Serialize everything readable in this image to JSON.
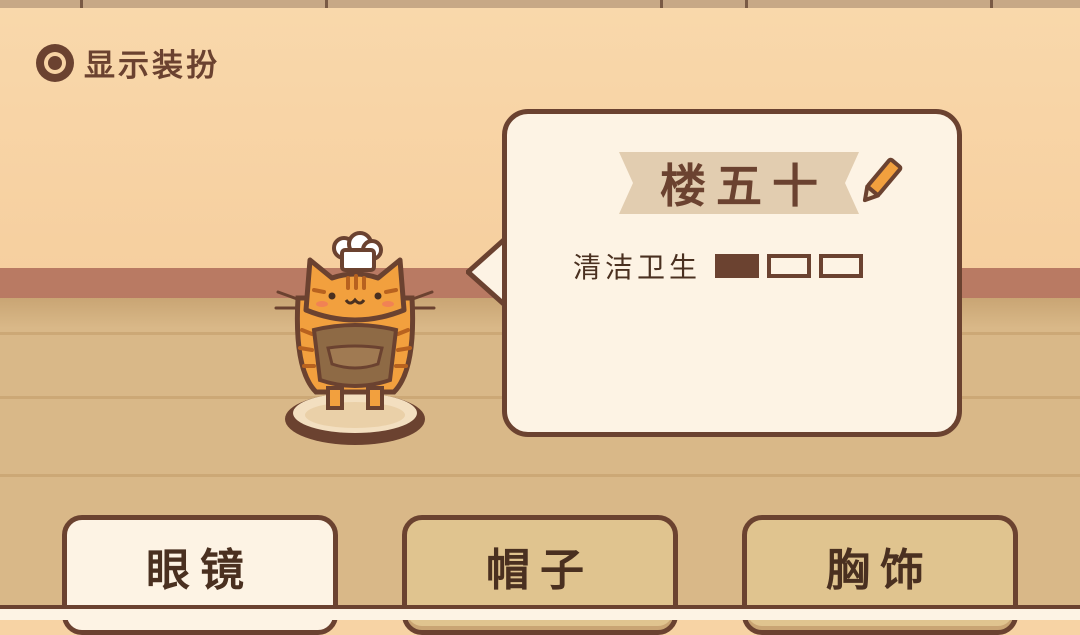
{
  "toggle": {
    "label": "显示装扮",
    "selected": true
  },
  "character": {
    "name": "楼五十",
    "stat": {
      "label": "清洁卫生",
      "level": 1,
      "max": 3
    }
  },
  "tabs": [
    {
      "label": "眼镜",
      "active": true
    },
    {
      "label": "帽子",
      "active": false
    },
    {
      "label": "胸饰",
      "active": false
    }
  ],
  "colors": {
    "outline": "#6b4230",
    "wall": "#f7d3a4",
    "floor": "#d9b888",
    "rail": "#b97a63",
    "panel": "#fdf3e4",
    "tab_inactive": "#e0c48f"
  },
  "icons": {
    "edit": "pencil-icon",
    "toggle": "radio-selected-icon"
  }
}
